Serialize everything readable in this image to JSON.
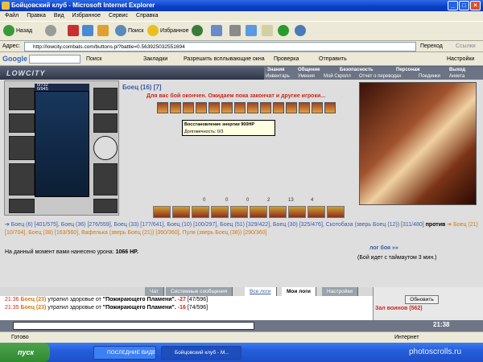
{
  "window": {
    "title": "Бойцовский клуб - Microsoft Internet Explorer"
  },
  "menu": [
    "Файл",
    "Правка",
    "Вид",
    "Избранное",
    "Сервис",
    "Справка"
  ],
  "toolbar": {
    "back": "Назад",
    "search": "Поиск",
    "favorites": "Избранное"
  },
  "address": {
    "label": "Адрес:",
    "url": "http://lowcity.combats.com/buttons.pl?battle=0.563925032551694",
    "go": "Переход",
    "links": "Ссылки"
  },
  "googlebar": {
    "search": "Поиск",
    "bookmarks": "Закладки",
    "popups": "Разрешить всплывающие окна",
    "check": "Проверка",
    "send": "Отправить",
    "settings": "Настройки"
  },
  "game": {
    "logo": "LOWCITY",
    "nav_top": [
      "Знания",
      "Общение",
      "Безопасность",
      "Персонаж",
      "Выход"
    ],
    "nav_bottom": [
      "Инвентарь",
      "Умения",
      "Мой Скролл",
      "Отчет о переводах",
      "Поединки",
      "Анкета"
    ],
    "hp": "0/732",
    "mp": "0/945",
    "hero": "Боец (16) [7]",
    "wait_msg": "Для вас бой окончен. Ожидаем пока закончат и другие игроки...",
    "tooltip_title": "Восстановление энергии 900HP",
    "tooltip_durability": "Долговечность: 0/3",
    "stats": [
      "0",
      "0",
      "0",
      "2",
      "13",
      "4"
    ],
    "team1": "➔ Боец (6) [401/575], Боец (36) [276/559], Боец (33) [177/641], Боец (10) [100/297], Боец (51) [329/422], Боец (30) [325/476], Скотобаза (зверь Боец (12)) [311/480]",
    "versus": "против",
    "team2": "➔ Боец (21) [10/704], Боец (38) [163/560], Вафелька (зверь Боец (21)) [360/360], Пуля (зверь Боец (38)) [290/360]",
    "damage_label": "На данный момент вами нанесено урона:",
    "damage_value": "1066 HP.",
    "log_link": "лог боя »»",
    "timeout": "(Бой идет с таймаутом 3 мин.)"
  },
  "chat": {
    "tabs": [
      "Чат",
      "Системные сообщения",
      "Все логи",
      "Мои логи",
      "Настройки"
    ],
    "lines": [
      {
        "time": "21:36",
        "who": "Боец (23)",
        "text": "утратил здоровье от",
        "src": "\"Пожирающего Пламени\".",
        "dmg": "-27",
        "hp": "[47/596]"
      },
      {
        "time": "21:35",
        "who": "Боец (23)",
        "text": "утратил здоровье от",
        "src": "\"Пожирающего Пламени\".",
        "dmg": "-16",
        "hp": "[74/596]"
      }
    ],
    "refresh": "Обновить",
    "hall": "Зал воинов (562)",
    "clock": "21:38"
  },
  "status": {
    "left": "Готово",
    "right": "Интернет"
  },
  "taskbar": {
    "start": "пуск",
    "tasks": [
      "ПОСЛЕДНИЕ ВИДЕО",
      "Бойцовский клуб - M..."
    ],
    "watermark": "photoscrolls.ru"
  }
}
